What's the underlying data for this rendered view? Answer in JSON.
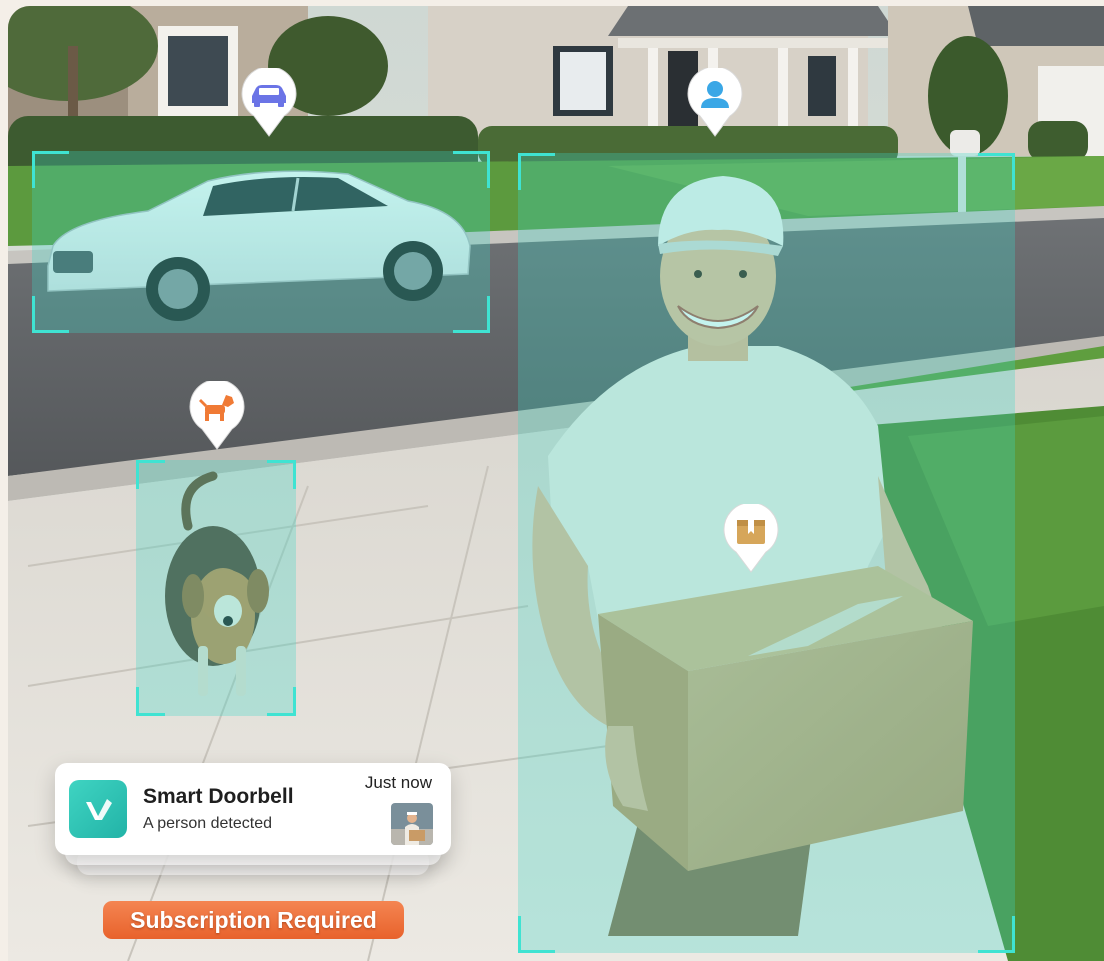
{
  "detections": [
    {
      "id": "vehicle",
      "icon": "car-icon"
    },
    {
      "id": "person",
      "icon": "person-icon"
    },
    {
      "id": "pet",
      "icon": "dog-icon"
    },
    {
      "id": "package",
      "icon": "package-icon"
    }
  ],
  "notification": {
    "app_icon": "app-logo-icon",
    "title": "Smart Doorbell",
    "body": "A person detected",
    "time": "Just now"
  },
  "badge": {
    "label": "Subscription Required"
  },
  "colors": {
    "detection_accent": "#3fe3d2",
    "detection_fill": "#3cd7c8",
    "pin_icon_car": "#6b74e6",
    "pin_icon_person": "#3aa7e6",
    "pin_icon_dog": "#f07a35",
    "pin_icon_package": "#d6a65a",
    "badge_orange": "#ec6a32",
    "app_teal": "#2cc3b4"
  }
}
